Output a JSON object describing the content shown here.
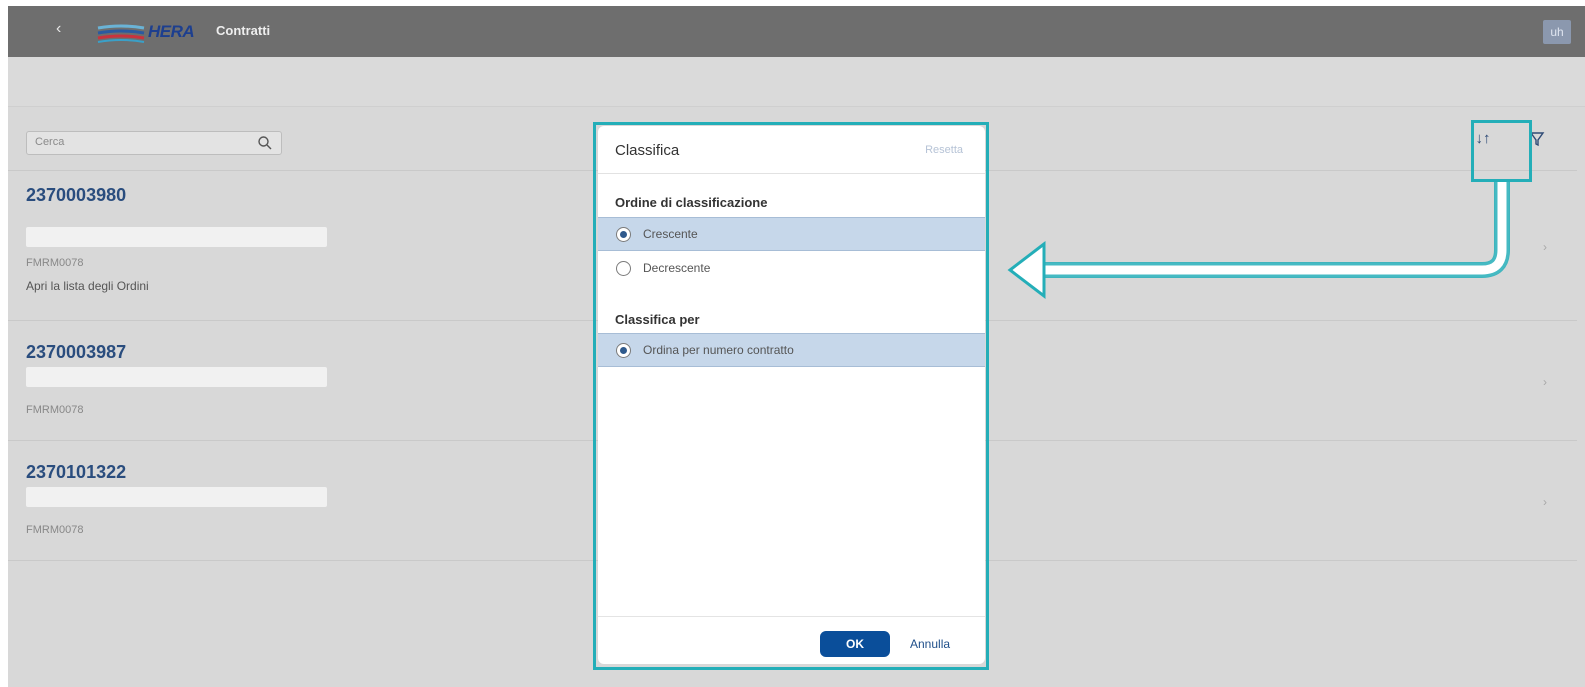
{
  "header": {
    "back_glyph": "‹",
    "logo_text": "HERA",
    "title": "Contratti",
    "user_initials": "uh"
  },
  "search": {
    "placeholder": "Cerca",
    "icon": "search-icon"
  },
  "toolbar": {
    "sort_icon": "sort-icon",
    "sort_glyph": "↓↑",
    "filter_icon": "filter-icon"
  },
  "contracts": [
    {
      "number": "2370003980",
      "code": "FMRM0078",
      "link": "Apri la lista degli Ordini"
    },
    {
      "number": "2370003987",
      "code": "FMRM0078"
    },
    {
      "number": "2370101322",
      "code": "FMRM0078"
    }
  ],
  "row_chevron": "›",
  "dialog": {
    "title": "Classifica",
    "reset_label": "Resetta",
    "order_section": "Ordine di classificazione",
    "order_options": [
      {
        "label": "Crescente",
        "selected": true
      },
      {
        "label": "Decrescente",
        "selected": false
      }
    ],
    "sort_by_section": "Classifica per",
    "sort_by_options": [
      {
        "label": "Ordina per numero contratto",
        "selected": true
      }
    ],
    "ok_label": "OK",
    "cancel_label": "Annulla"
  },
  "colors": {
    "highlight": "#24aeb8",
    "primary": "#0a4e9a",
    "selected_row": "#c6d7ea"
  }
}
